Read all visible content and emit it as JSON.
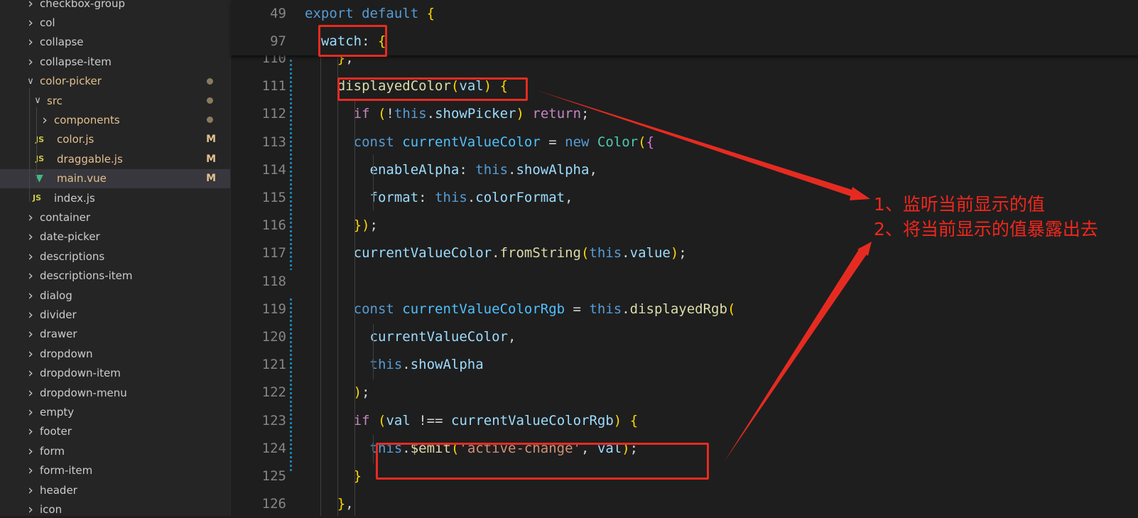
{
  "explorer": {
    "items": [
      {
        "label": "checkbox-group",
        "type": "folder",
        "state": "collapsed",
        "status": ""
      },
      {
        "label": "col",
        "type": "folder",
        "state": "collapsed",
        "status": ""
      },
      {
        "label": "collapse",
        "type": "folder",
        "state": "collapsed",
        "status": ""
      },
      {
        "label": "collapse-item",
        "type": "folder",
        "state": "collapsed",
        "status": ""
      },
      {
        "label": "color-picker",
        "type": "folder",
        "state": "expanded",
        "status": "dot"
      },
      {
        "label": "src",
        "type": "folder",
        "state": "expanded",
        "status": "dot"
      },
      {
        "label": "components",
        "type": "folder",
        "state": "collapsed",
        "status": "dot"
      },
      {
        "label": "color.js",
        "type": "js",
        "status": "M"
      },
      {
        "label": "draggable.js",
        "type": "js",
        "status": "M"
      },
      {
        "label": "main.vue",
        "type": "vue",
        "status": "M",
        "selected": true
      },
      {
        "label": "index.js",
        "type": "js",
        "status": ""
      },
      {
        "label": "container",
        "type": "folder",
        "state": "collapsed",
        "status": ""
      },
      {
        "label": "date-picker",
        "type": "folder",
        "state": "collapsed",
        "status": ""
      },
      {
        "label": "descriptions",
        "type": "folder",
        "state": "collapsed",
        "status": ""
      },
      {
        "label": "descriptions-item",
        "type": "folder",
        "state": "collapsed",
        "status": ""
      },
      {
        "label": "dialog",
        "type": "folder",
        "state": "collapsed",
        "status": ""
      },
      {
        "label": "divider",
        "type": "folder",
        "state": "collapsed",
        "status": ""
      },
      {
        "label": "drawer",
        "type": "folder",
        "state": "collapsed",
        "status": ""
      },
      {
        "label": "dropdown",
        "type": "folder",
        "state": "collapsed",
        "status": ""
      },
      {
        "label": "dropdown-item",
        "type": "folder",
        "state": "collapsed",
        "status": ""
      },
      {
        "label": "dropdown-menu",
        "type": "folder",
        "state": "collapsed",
        "status": ""
      },
      {
        "label": "empty",
        "type": "folder",
        "state": "collapsed",
        "status": ""
      },
      {
        "label": "footer",
        "type": "folder",
        "state": "collapsed",
        "status": ""
      },
      {
        "label": "form",
        "type": "folder",
        "state": "collapsed",
        "status": ""
      },
      {
        "label": "form-item",
        "type": "folder",
        "state": "collapsed",
        "status": ""
      },
      {
        "label": "header",
        "type": "folder",
        "state": "collapsed",
        "status": ""
      },
      {
        "label": "icon",
        "type": "folder",
        "state": "collapsed",
        "status": ""
      }
    ]
  },
  "editor": {
    "sticky_lines": [
      {
        "number": "49",
        "code": "export default {"
      },
      {
        "number": "97",
        "code": "  watch: {"
      }
    ],
    "lines": [
      {
        "number": "110",
        "code": "    },"
      },
      {
        "number": "111",
        "code": "    displayedColor(val) {"
      },
      {
        "number": "112",
        "code": "      if (!this.showPicker) return;"
      },
      {
        "number": "113",
        "code": "      const currentValueColor = new Color({"
      },
      {
        "number": "114",
        "code": "        enableAlpha: this.showAlpha,"
      },
      {
        "number": "115",
        "code": "        format: this.colorFormat,"
      },
      {
        "number": "116",
        "code": "      });"
      },
      {
        "number": "117",
        "code": "      currentValueColor.fromString(this.value);"
      },
      {
        "number": "118",
        "code": ""
      },
      {
        "number": "119",
        "code": "      const currentValueColorRgb = this.displayedRgb("
      },
      {
        "number": "120",
        "code": "        currentValueColor,"
      },
      {
        "number": "121",
        "code": "        this.showAlpha"
      },
      {
        "number": "122",
        "code": "      );"
      },
      {
        "number": "123",
        "code": "      if (val !== currentValueColorRgb) {"
      },
      {
        "number": "124",
        "code": "        this.$emit('active-change', val);"
      },
      {
        "number": "125",
        "code": "      }"
      },
      {
        "number": "126",
        "code": "    },"
      }
    ]
  },
  "annotations": {
    "color": "#e52b21",
    "notes": [
      "1、监听当前显示的值",
      "2、将当前显示的值暴露出去"
    ]
  }
}
